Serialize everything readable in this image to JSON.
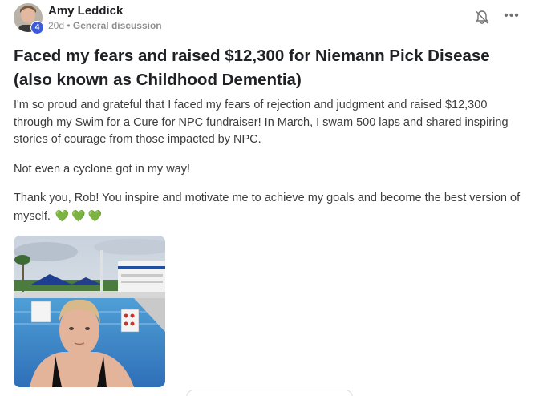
{
  "post": {
    "author": "Amy Leddick",
    "level": "4",
    "age": "20d",
    "separator": "•",
    "category": "General discussion",
    "title": "Faced my fears and raised $12,300 for Niemann Pick Disease (also known as Childhood Dementia)",
    "paragraphs": [
      "I'm so proud and grateful that I faced my fears of rejection and judgment and raised $12,300 through my Swim for a Cure for NPC fundraiser! In March, I swam 500 laps and shared inspiring stories of courage from those impacted by NPC.",
      "Not even a cyclone got in my way!",
      "Thank you, Rob! You inspire and motivate me to achieve my goals and become the best version of myself."
    ],
    "hearts": [
      "💚",
      "💚",
      "💚"
    ],
    "more_icon": "•••"
  },
  "icons": {
    "bell": "bell-off-icon",
    "more": "more-horizontal-icon"
  },
  "colors": {
    "level_badge": "#3b5bdb",
    "heart": "#2fc46b"
  }
}
